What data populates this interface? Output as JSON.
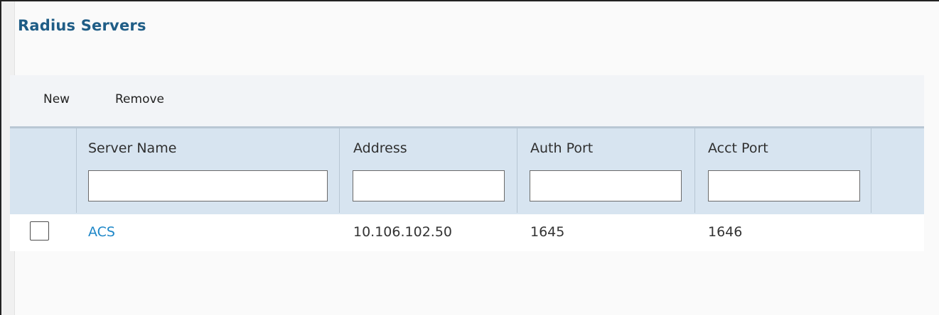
{
  "page": {
    "title": "Radius Servers"
  },
  "toolbar": {
    "new_label": "New",
    "remove_label": "Remove"
  },
  "table": {
    "columns": [
      "Server Name",
      "Address",
      "Auth Port",
      "Acct Port"
    ],
    "filters": [
      "",
      "",
      "",
      ""
    ],
    "rows": [
      {
        "checked": false,
        "server_name": "ACS",
        "address": "10.106.102.50",
        "auth_port": "1645",
        "acct_port": "1646"
      }
    ]
  },
  "colors": {
    "title": "#1f5d86",
    "link": "#1e87c8",
    "header_bg": "#d7e4f0",
    "toolbar_bg": "#f2f4f7"
  }
}
